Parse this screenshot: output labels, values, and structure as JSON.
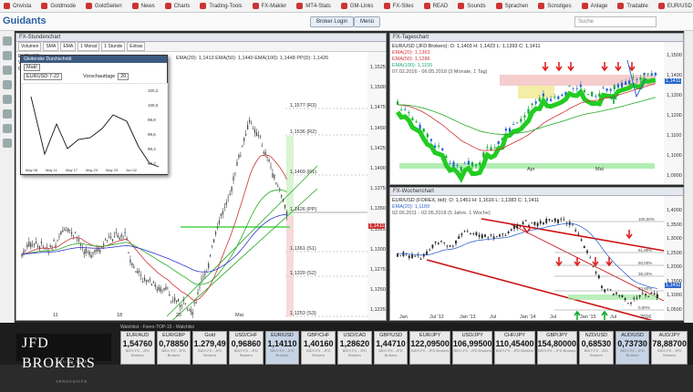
{
  "browser": {
    "bookmarks": [
      {
        "label": "Onvista"
      },
      {
        "label": "Goldmode"
      },
      {
        "label": "GoldSeiten"
      },
      {
        "label": "News"
      },
      {
        "label": "Charts"
      },
      {
        "label": "Trading-Tools"
      },
      {
        "label": "FX-Makler"
      },
      {
        "label": "MT4-Stats"
      },
      {
        "label": "GM-Links"
      },
      {
        "label": "FX-Sites"
      },
      {
        "label": "READ"
      },
      {
        "label": "Sounds"
      },
      {
        "label": "Sprachen"
      },
      {
        "label": "Sonstiges"
      },
      {
        "label": "Anlage"
      },
      {
        "label": "Tradable"
      },
      {
        "label": "EUR/USD - DESK"
      },
      {
        "label": "SeasonalBull"
      },
      {
        "label": "JFD - YouTube"
      },
      {
        "label": "Meldung"
      }
    ]
  },
  "app": {
    "logo": "Guidants",
    "buttons": {
      "login": "Broker Login",
      "menu": "Menü"
    },
    "search_placeholder": "Suche"
  },
  "panes": {
    "left": {
      "title": "FX-Stundenchart",
      "toolbar": [
        "Volumen",
        "SMA",
        "EMA",
        "1 Monat",
        "1 Stunde",
        "Extras"
      ],
      "legend": [
        "EURUSD",
        "Vorlage",
        "06.04.2018"
      ],
      "ema_line": "EMA(20): 1,1413  EMA(50): 1,1440  EMA(100): 1,1448  PP(D): 1,1426",
      "levels": [
        {
          "label": "1,1577 (R3)",
          "color": "#333"
        },
        {
          "label": "1,1536 (R2)",
          "color": "#333"
        },
        {
          "label": "1,1469 (R1)",
          "color": "#333"
        },
        {
          "label": "1,1426 (PP)",
          "color": "#333"
        },
        {
          "label": "1,1361 (S1)",
          "color": "#333"
        },
        {
          "label": "1,1320 (S2)",
          "color": "#333"
        },
        {
          "label": "1,1253 (S3)",
          "color": "#333"
        }
      ],
      "yaxis": [
        "1,1525",
        "1,1500",
        "1,1475",
        "1,1450",
        "1,1425",
        "1,1400",
        "1,1375",
        "1,1350",
        "1,1325",
        "1,1300",
        "1,1275",
        "1,1250",
        "1,1225"
      ],
      "xaxis": [
        "11",
        "18",
        "25",
        "Mai"
      ],
      "last_price": "1,1411",
      "popup": {
        "title": "Gleitender Durchschnitt",
        "field1": "Makl",
        "symbol": "EURUSD-7-22",
        "label": "Vorschauttage",
        "value": "20",
        "yaxis": [
          "100,2",
          "100,0",
          "99,8",
          "99,6",
          "99,4",
          "99,2"
        ],
        "xaxis": [
          "May 08",
          "May 11",
          "May 17",
          "May 23",
          "May 29",
          "Jun 02"
        ]
      }
    },
    "top_right": {
      "title": "FX-Tageschart",
      "legend": [
        "EUR/USD (JFD Brokers): O: 1,1403  H: 1,1423  L: 1,1393  C: 1,1411",
        "EMA(20): 1,1363",
        "EMA(50): 1,1286",
        "EMA(100): 1,1155",
        "07.02.2016 - 06.05.2018 (3 Monate, 1 Tag)"
      ],
      "yaxis": [
        "1,1500",
        "1,1400",
        "1,1300",
        "1,1200",
        "1,1100",
        "1,1000",
        "1,0900"
      ],
      "xaxis": [
        "Apr",
        "Mai"
      ],
      "last_price": "1,1411"
    },
    "bottom_right": {
      "title": "FX-Wochenchart",
      "legend": [
        "EUR/USD (FOREX, bid): O: 1,1451  H: 1,1616  L: 1,1383  C: 1,1411",
        "EMA(20): 1,1189",
        "02.06.2011 - 02.05.2018 (5 Jahre, 1 Woche)"
      ],
      "fib": [
        "100,00%",
        "61,80%",
        "50,00%",
        "38,20%",
        "23,60%",
        "0,00%"
      ],
      "yaxis": [
        "1,4000",
        "1,3500",
        "1,3000",
        "1,2500",
        "1,2000",
        "1,1500",
        "1,1000",
        "1,0500"
      ],
      "xaxis": [
        "Jan",
        "Jul '12",
        "Jan '13",
        "Jul",
        "Jan '14",
        "Jul",
        "Jan '15",
        "Jul",
        "2016"
      ],
      "last_price": "1,1411"
    }
  },
  "watchlist": {
    "title": "Watchlist - Forex-TOP-15 - Watchlist",
    "brand": "JFD BROKERS",
    "brand_sub": "TRUST. FAIR. INNOVATIVE.",
    "tiles": [
      {
        "name": "EUR/AUD",
        "value": "1,54760",
        "src": "BIDY-FX - JFD Brokers"
      },
      {
        "name": "EUR/GBP",
        "value": "0,78850",
        "src": "BIDY-FX - JFD Brokers"
      },
      {
        "name": "Gold",
        "value": "1.279,49",
        "src": "BIDY-FX - JFD Brokers"
      },
      {
        "name": "USD/CHF",
        "value": "0,96860",
        "src": "BIDY-FX - JFD Brokers"
      },
      {
        "name": "EUR/USD",
        "value": "1,14110",
        "src": "BIDY-FX - JFD Brokers"
      },
      {
        "name": "GBP/CHF",
        "value": "1,40160",
        "src": "BIDY-FX - JFD Brokers"
      },
      {
        "name": "USD/CAD",
        "value": "1,28620",
        "src": "BIDY-FX - JFD Brokers"
      },
      {
        "name": "GBP/USD",
        "value": "1,44710",
        "src": "BIDY-FX - JFD Brokers"
      },
      {
        "name": "EUR/JPY",
        "value": "122,09500",
        "src": "BIDY-FX - JFD Brokers"
      },
      {
        "name": "USD/JPY",
        "value": "106,99500",
        "src": "BIDY-FX - JFD Brokers"
      },
      {
        "name": "CHF/JPY",
        "value": "110,45400",
        "src": "BIDY-FX - JFD Brokers"
      },
      {
        "name": "GBP/JPY",
        "value": "154,80000",
        "src": "BIDY-FX - JFD Brokers"
      },
      {
        "name": "NZD/USD",
        "value": "0,68530",
        "src": "BIDY-FX - JFD Brokers"
      },
      {
        "name": "AUD/USD",
        "value": "0,73730",
        "src": "BIDY-FX - JFD Brokers"
      },
      {
        "name": "AUD/JPY",
        "value": "78,88700",
        "src": "BIDY-FX - JFD Brokers"
      }
    ]
  }
}
